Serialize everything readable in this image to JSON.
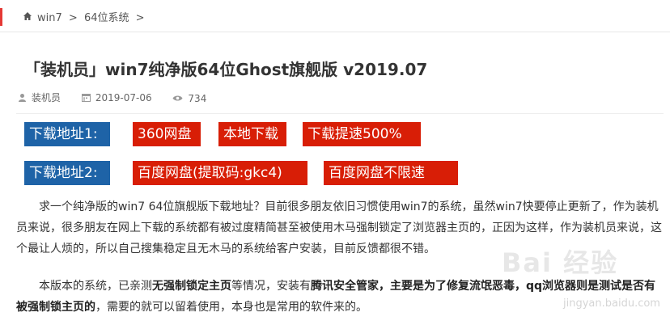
{
  "breadcrumb": {
    "items": [
      "win7",
      ">",
      "64位系统",
      ">"
    ]
  },
  "article": {
    "title": "「装机员」win7纯净版64位Ghost旗舰版 v2019.07",
    "author": "装机员",
    "date": "2019-07-06",
    "views": "734"
  },
  "downloads": {
    "row1": {
      "label": "下载地址1:",
      "links": [
        "360网盘",
        "本地下载",
        "下载提速500%"
      ]
    },
    "row2": {
      "label": "下载地址2:",
      "links": [
        "百度网盘(提取码:gkc4)",
        "百度网盘不限速"
      ]
    }
  },
  "paragraphs": {
    "p1": "求一个纯净版的win7 64位旗舰版下载地址？目前很多朋友依旧习惯使用win7的系统，虽然win7快要停止更新了，作为装机员来说，很多朋友在网上下载的系统都有被过度精简甚至被使用木马强制锁定了浏览器主页的，正因为这样，作为装机员来说，这个最让人烦的，所以自己搜集稳定且无木马的系统给客户安装，目前反馈都很不错。",
    "p2": {
      "t1": "本版本的系统，已亲测",
      "b1": "无强制锁定主页",
      "t2": "等情况，安装有",
      "b2": "腾讯安全管家，主要是为了修复流氓恶毒，qq浏览器则是测试是否有被强制锁主页的",
      "t3": "，需要的就可以留着使用，本身也是常用的软件来的。"
    }
  },
  "watermark": {
    "main": "Bai 经验",
    "url": "jingyan.baidu.com"
  },
  "colors": {
    "label_bg": "#1e63a7",
    "link_bg": "#d81e06",
    "accent_bar": "#e53935"
  },
  "icons": {
    "home": "home-icon",
    "user": "user-icon",
    "calendar": "calendar-icon",
    "eye": "eye-icon"
  }
}
